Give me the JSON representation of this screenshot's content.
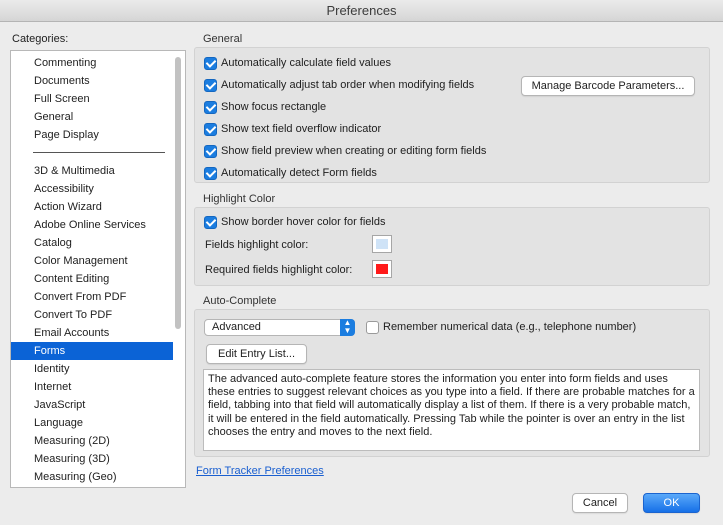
{
  "window": {
    "title": "Preferences"
  },
  "categories": {
    "label": "Categories:",
    "top_items": [
      "Commenting",
      "Documents",
      "Full Screen",
      "General",
      "Page Display"
    ],
    "items": [
      "3D & Multimedia",
      "Accessibility",
      "Action Wizard",
      "Adobe Online Services",
      "Catalog",
      "Color Management",
      "Content Editing",
      "Convert From PDF",
      "Convert To PDF",
      "Email Accounts",
      "Forms",
      "Identity",
      "Internet",
      "JavaScript",
      "Language",
      "Measuring (2D)",
      "Measuring (3D)",
      "Measuring (Geo)"
    ],
    "selected": "Forms"
  },
  "general": {
    "label": "General",
    "options": [
      {
        "label": "Automatically calculate field values",
        "checked": true
      },
      {
        "label": "Automatically adjust tab order when modifying fields",
        "checked": true
      },
      {
        "label": "Show focus rectangle",
        "checked": true
      },
      {
        "label": "Show text field overflow indicator",
        "checked": true
      },
      {
        "label": "Show field preview when creating or editing form fields",
        "checked": true
      },
      {
        "label": "Automatically detect Form fields",
        "checked": true
      }
    ],
    "barcode_button": "Manage Barcode Parameters..."
  },
  "highlight": {
    "label": "Highlight Color",
    "hover_option": {
      "label": "Show border hover color for fields",
      "checked": true
    },
    "fields_label": "Fields highlight color:",
    "fields_color": "#cfe3f7",
    "required_label": "Required fields highlight color:",
    "required_color": "#ff1a1a"
  },
  "autocomplete": {
    "label": "Auto-Complete",
    "mode": "Advanced",
    "remember_label": "Remember numerical data (e.g., telephone number)",
    "remember_checked": false,
    "edit_button": "Edit Entry List...",
    "description": "The advanced auto-complete feature stores the information you enter into form fields and uses these entries to suggest relevant choices as you type into a field. If there are probable matches for a field, tabbing into that field will automatically display a list of them. If there is a very probable match, it will be entered in the field automatically. Pressing Tab while the pointer is over an entry in the list chooses the entry and moves to the next field."
  },
  "footer": {
    "tracker_link": "Form Tracker Preferences",
    "cancel": "Cancel",
    "ok": "OK"
  },
  "colors": {
    "accent": "#1b7de0",
    "selection": "#0b63d6"
  }
}
